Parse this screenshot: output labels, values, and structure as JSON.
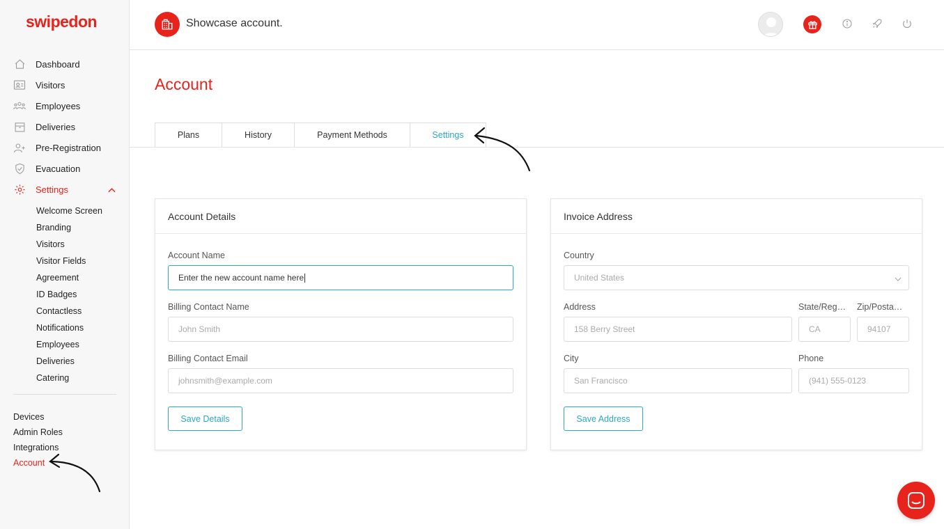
{
  "brand": {
    "logo_text": "swipedon",
    "accent": "#e8231c",
    "link": "#2aa7c9"
  },
  "header": {
    "org_name": "Showcase account."
  },
  "sidebar": {
    "items": [
      {
        "label": "Dashboard",
        "icon": "home-icon"
      },
      {
        "label": "Visitors",
        "icon": "id-card-icon"
      },
      {
        "label": "Employees",
        "icon": "people-icon"
      },
      {
        "label": "Deliveries",
        "icon": "box-icon"
      },
      {
        "label": "Pre-Registration",
        "icon": "add-user-icon"
      },
      {
        "label": "Evacuation",
        "icon": "shield-icon"
      },
      {
        "label": "Settings",
        "icon": "gear-icon"
      }
    ],
    "settings_sub": [
      "Welcome Screen",
      "Branding",
      "Visitors",
      "Visitor Fields",
      "Agreement",
      "ID Badges",
      "Contactless",
      "Notifications",
      "Employees",
      "Deliveries",
      "Catering"
    ],
    "bottom": [
      "Devices",
      "Admin Roles",
      "Integrations",
      "Account"
    ]
  },
  "page": {
    "title": "Account"
  },
  "tabs": [
    "Plans",
    "History",
    "Payment Methods",
    "Settings"
  ],
  "account_details": {
    "title": "Account Details",
    "account_name_label": "Account Name",
    "account_name_value": "Enter the new account name here",
    "billing_name_label": "Billing Contact Name",
    "billing_name_placeholder": "John Smith",
    "billing_email_label": "Billing Contact Email",
    "billing_email_placeholder": "johnsmith@example.com",
    "save_label": "Save Details"
  },
  "invoice_address": {
    "title": "Invoice Address",
    "country_label": "Country",
    "country_value": "United States",
    "address_label": "Address",
    "address_placeholder": "158 Berry Street",
    "state_label": "State/Reg…",
    "state_placeholder": "CA",
    "zip_label": "Zip/Posta…",
    "zip_placeholder": "94107",
    "city_label": "City",
    "city_placeholder": "San Francisco",
    "phone_label": "Phone",
    "phone_placeholder": "(941) 555-0123",
    "save_label": "Save Address"
  }
}
